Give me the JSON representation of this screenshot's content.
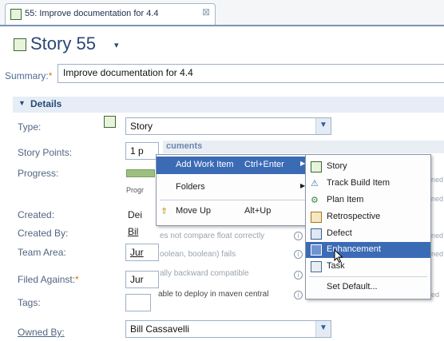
{
  "tab": {
    "title": "55: Improve documentation for 4.4",
    "close": "⊠"
  },
  "header": {
    "title": "Story 55",
    "chevron": "▾"
  },
  "summary": {
    "label": "Summary:",
    "required": "*",
    "value": "Improve documentation for 4.4"
  },
  "details": {
    "title": "Details",
    "toggle": "▼",
    "fields": {
      "type": {
        "label": "Type:",
        "value": "Story"
      },
      "story_points": {
        "label": "Story Points:",
        "value": "1 p"
      },
      "progress": {
        "label": "Progress:",
        "value": "Progr"
      },
      "created": {
        "label": "Created:",
        "value": "Dei"
      },
      "created_by": {
        "label": "Created By:",
        "value": "Bil"
      },
      "team_area": {
        "label": "Team Area:",
        "value": "Jur"
      },
      "filed_against": {
        "label": "Filed Against:",
        "required": "*",
        "value": "Jur"
      },
      "tags": {
        "label": "Tags:",
        "value": ""
      },
      "owned_by": {
        "label": "Owned By:",
        "value": "Bill Cassavelli"
      }
    }
  },
  "background": {
    "section_header": "cuments",
    "items": [
      "es not compare float correctly",
      "oolean, boolean) fails",
      "ally backward compatible",
      "able to deploy in maven central"
    ],
    "right_fragments": [
      "ned",
      "ned",
      "ned",
      "ned",
      "ed"
    ]
  },
  "context_menu": {
    "items": [
      {
        "label": "Add Work Item",
        "shortcut": "Ctrl+Enter",
        "has_submenu": true
      },
      {
        "label": "Folders",
        "shortcut": "",
        "has_submenu": true
      },
      {
        "label": "Move Up",
        "shortcut": "Alt+Up",
        "has_submenu": false
      }
    ]
  },
  "submenu": {
    "items": [
      {
        "label": "Story",
        "icon": "story-icon"
      },
      {
        "label": "Track Build Item",
        "icon": "track-build-icon"
      },
      {
        "label": "Plan Item",
        "icon": "plan-item-icon"
      },
      {
        "label": "Retrospective",
        "icon": "retrospective-icon"
      },
      {
        "label": "Defect",
        "icon": "defect-icon"
      },
      {
        "label": "Enhancement",
        "icon": "enhancement-icon"
      },
      {
        "label": "Task",
        "icon": "task-icon"
      }
    ],
    "set_default": "Set Default...",
    "selected": "Enhancement"
  },
  "colors": {
    "accent": "#3b6bb5",
    "header_text": "#2b4676",
    "required": "#cf7a12"
  }
}
